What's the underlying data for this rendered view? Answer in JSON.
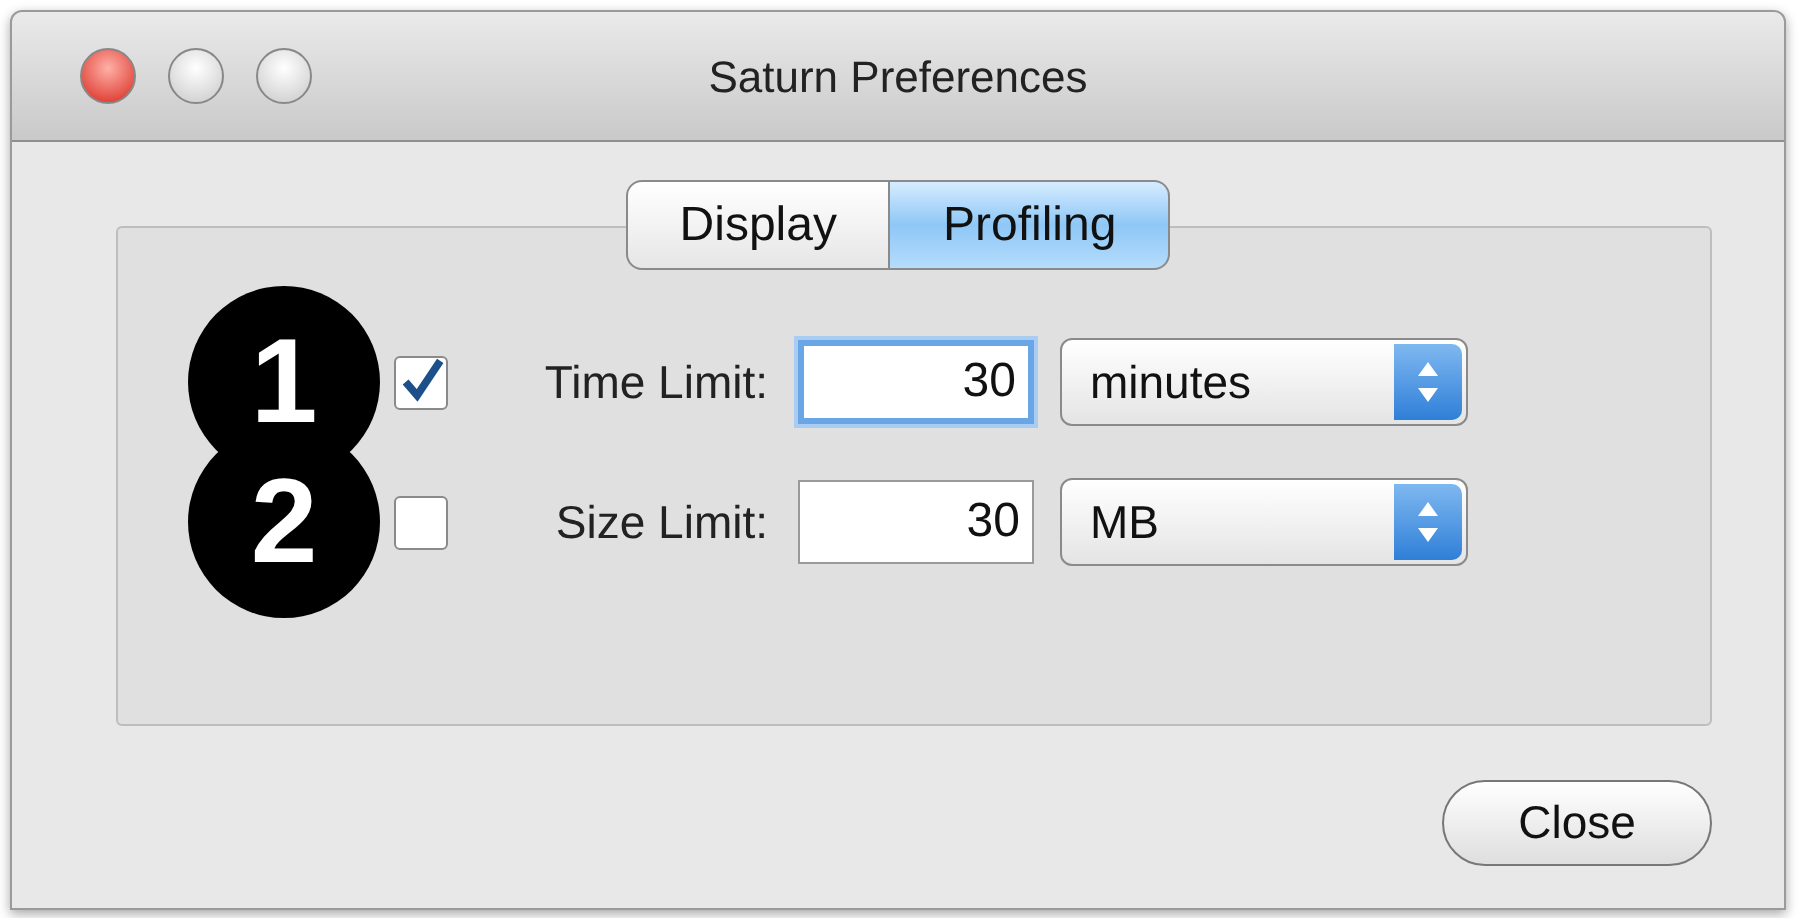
{
  "window": {
    "title": "Saturn Preferences"
  },
  "tabs": [
    {
      "label": "Display",
      "selected": false
    },
    {
      "label": "Profiling",
      "selected": true
    }
  ],
  "limits": [
    {
      "callout": "1",
      "label": "Time Limit:",
      "checked": true,
      "value": "30",
      "focused": true,
      "unit": "minutes"
    },
    {
      "callout": "2",
      "label": "Size Limit:",
      "checked": false,
      "value": "30",
      "focused": false,
      "unit": "MB"
    }
  ],
  "buttons": [
    "Close"
  ]
}
